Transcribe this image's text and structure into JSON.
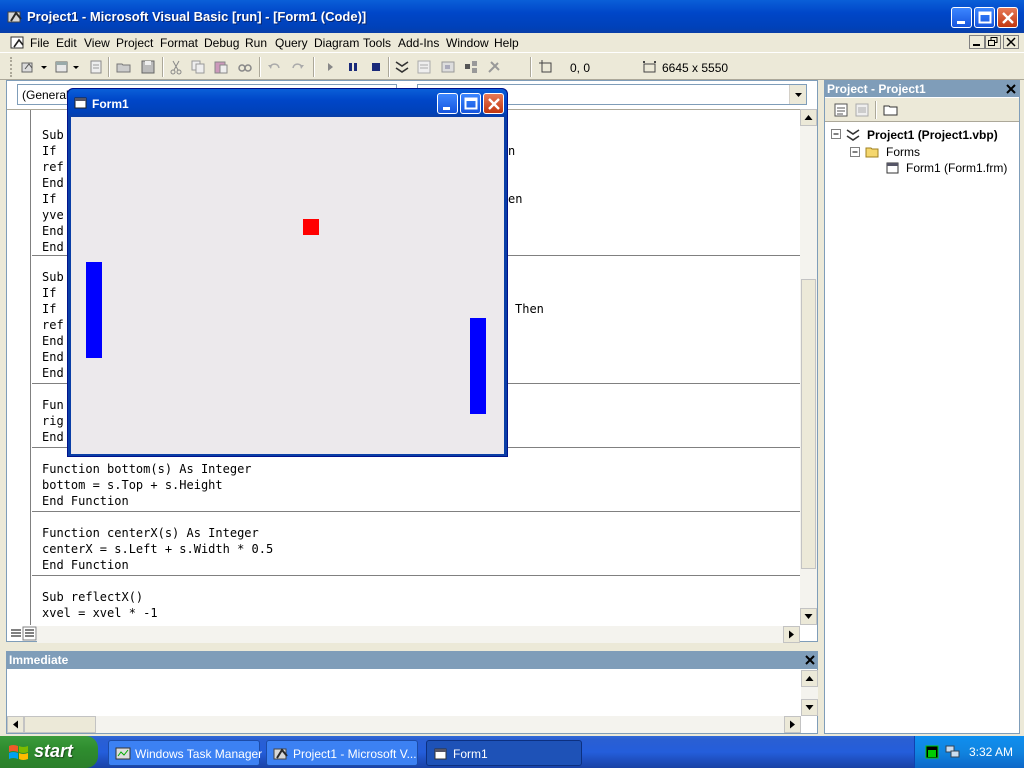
{
  "window": {
    "title": "Project1 - Microsoft Visual Basic [run] - [Form1 (Code)]"
  },
  "menu": [
    "File",
    "Edit",
    "View",
    "Project",
    "Format",
    "Debug",
    "Run",
    "Query",
    "Diagram",
    "Tools",
    "Add-Ins",
    "Window",
    "Help"
  ],
  "toolbar": {
    "position": "0, 0",
    "size": "6645 x 5550"
  },
  "code_window": {
    "object_combo": "(General)",
    "lines": {
      "p1": [
        "Sub",
        "If",
        "ref",
        "End",
        "If",
        "yve",
        "End",
        "End"
      ],
      "p1_frag": [
        "n",
        "",
        "",
        "",
        "en"
      ],
      "p2": [
        "Sub",
        "If",
        "If",
        "ref",
        "End",
        "End",
        "End"
      ],
      "p2_frag": [
        "",
        "",
        "Then"
      ],
      "p3": [
        "Fun",
        "rig",
        "End"
      ],
      "p4": [
        "Function bottom(s) As Integer",
        "bottom = s.Top + s.Height",
        "End Function"
      ],
      "p5": [
        "Function centerX(s) As Integer",
        "centerX = s.Left + s.Width * 0.5",
        "End Function"
      ],
      "p6": [
        "Sub reflectX()",
        "xvel = xvel * -1"
      ]
    }
  },
  "form1": {
    "title": "Form1",
    "ball_color": "#ff0000",
    "paddle_color": "#0000ff"
  },
  "project_panel": {
    "title": "Project - Project1",
    "tree": {
      "project": "Project1 (Project1.vbp)",
      "folder": "Forms",
      "form": "Form1 (Form1.frm)"
    }
  },
  "immediate": {
    "title": "Immediate"
  },
  "taskbar": {
    "start": "start",
    "tasks": [
      "Windows Task Manager",
      "Project1 - Microsoft V...",
      "Form1"
    ],
    "clock": "3:32 AM"
  }
}
